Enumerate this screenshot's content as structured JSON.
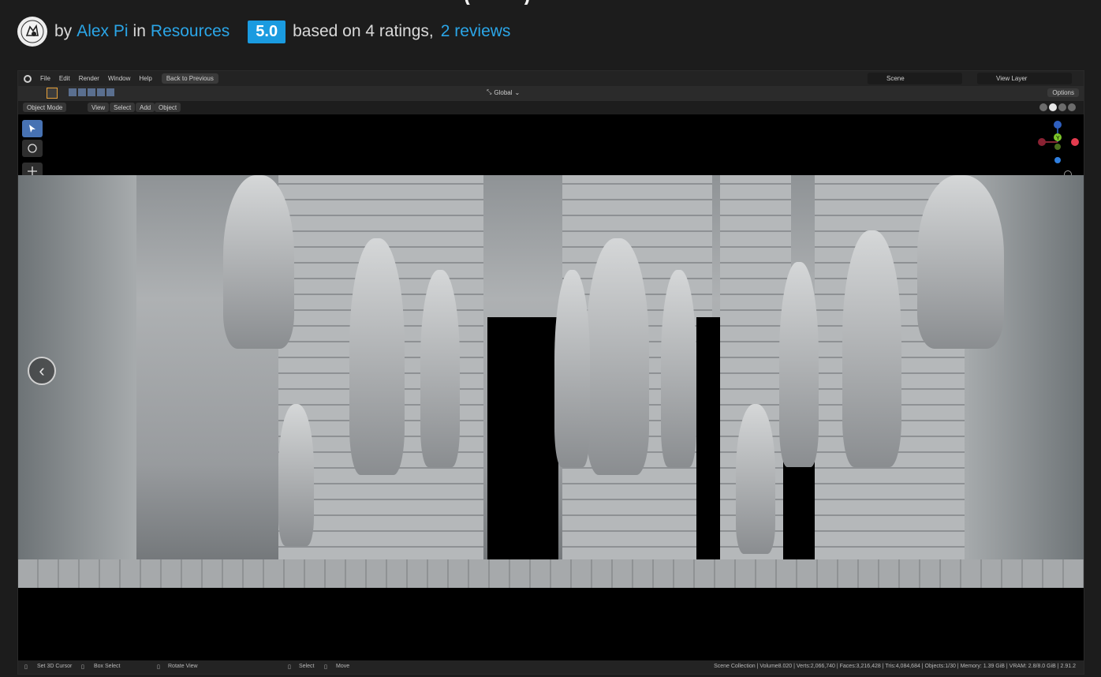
{
  "header": {
    "title_fragment": "( )",
    "by": "by",
    "author": "Alex Pi",
    "in": "in",
    "category": "Resources",
    "rating": "5.0",
    "ratings_text": "based on 4 ratings,",
    "reviews_link": "2 reviews"
  },
  "blender": {
    "menu": [
      "File",
      "Edit",
      "Render",
      "Window",
      "Help"
    ],
    "back_button": "Back to Previous",
    "scene": "Scene",
    "view_layer": "View Layer",
    "transform_orientation": "Global",
    "options": "Options",
    "object_mode": "Object Mode",
    "header_menus": [
      "View",
      "Select",
      "Add",
      "Object"
    ],
    "gizmo_axis": "Y",
    "status": {
      "set_cursor": "Set 3D Cursor",
      "box_select": "Box Select",
      "rotate_view": "Rotate View",
      "select": "Select",
      "move": "Move",
      "stats": "Scene Collection | Volume8.020 | Verts:2,066,740 | Faces:3,216,428 | Tris:4,084,684 | Objects:1/30 | Memory: 1.39 GiB | VRAM: 2.8/8.0 GiB | 2.91.2"
    }
  },
  "colors": {
    "link": "#2ba6e8",
    "badge": "#1a9be0",
    "active_tool": "#4772b3"
  }
}
